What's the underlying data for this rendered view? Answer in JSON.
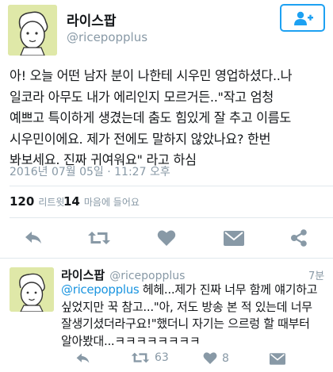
{
  "tweet": {
    "display_name": "라이스팝",
    "handle": "@ricepopplus",
    "lines": [
      "아! 오늘 어떤 남자 분이 나한테 시우민 영업하셨다..나",
      "일코라 아무도 내가 에리인지 모르거든..\"작고 엄청",
      "예쁘고 특이하게 생겼는데 춤도 힘있게 잘 추고 이름도",
      "시우민이에요. 제가 전에도 말하지 않았나요? 한번",
      "봐보세요. 진짜 귀여워요\" 라고 하심"
    ],
    "timestamp": "2016년 07월 05일 · 11:27 오후",
    "retweet_count": "120",
    "retweet_label": "리트윗",
    "like_count": "14",
    "like_label": "마음에 들어요"
  },
  "icons": {
    "follow": "add-user-icon",
    "reply": "reply-icon",
    "retweet": "retweet-icon",
    "like": "heart-icon",
    "message": "envelope-icon",
    "share": "share-icon"
  },
  "reply_tweet": {
    "display_name": "라이스팝",
    "handle": "@ricepopplus",
    "time": "7분",
    "mention": "@ricepopplus",
    "line1_rest": " 헤헤...제가 진짜 너무 함께 얘기하고",
    "lines": [
      "싶었지만 꾹 참고...\"아, 저도 방송 본 적 있는데 너무",
      "잘생기셨더라구요!\"했더니 자기는 으르렁 할 때부터",
      "알아봤대...ㅋㅋㅋㅋㅋㅋㅋㅋ"
    ],
    "retweet_count": "63",
    "like_count": "8"
  },
  "colors": {
    "accent": "#1da1f2",
    "muted": "#8899a6",
    "icon_gray": "#8899a6",
    "avatar_bg": "#dfe8a8"
  }
}
